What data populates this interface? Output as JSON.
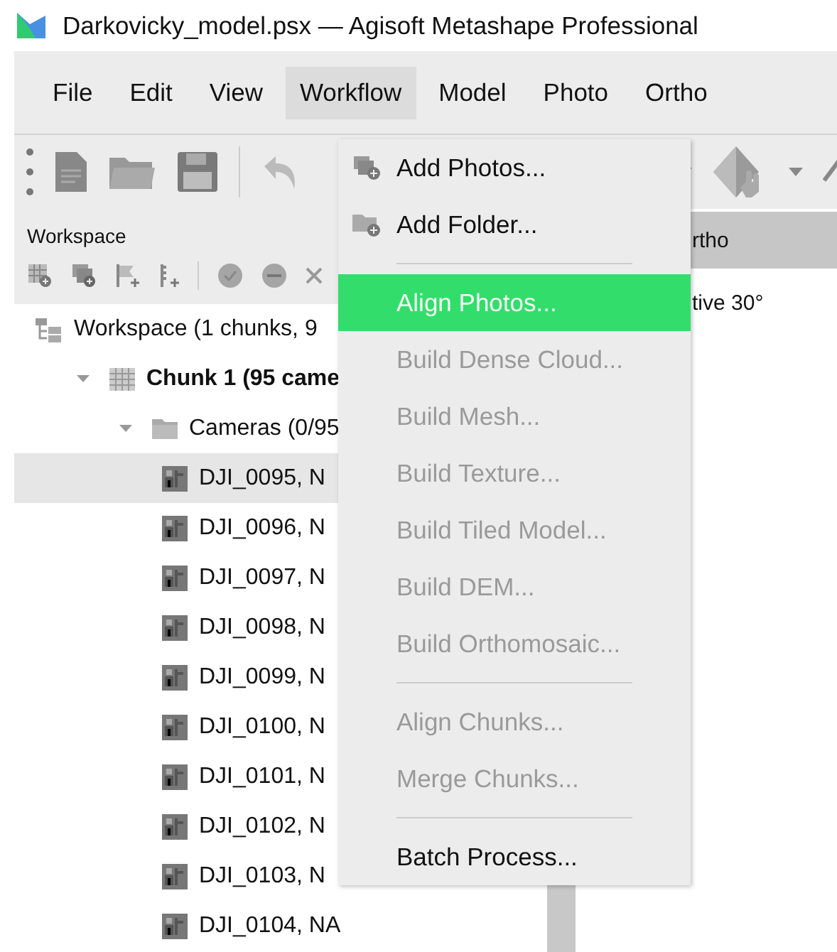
{
  "window": {
    "title": "Darkovicky_model.psx — Agisoft Metashape Professional"
  },
  "menu_bar": [
    {
      "label": "File",
      "selected": false
    },
    {
      "label": "Edit",
      "selected": false
    },
    {
      "label": "View",
      "selected": false
    },
    {
      "label": "Workflow",
      "selected": true
    },
    {
      "label": "Model",
      "selected": false
    },
    {
      "label": "Photo",
      "selected": false
    },
    {
      "label": "Ortho",
      "selected": false
    }
  ],
  "workspace_panel": {
    "title": "Workspace",
    "tree": [
      {
        "kind": "workspace",
        "label": "Workspace (1 chunks, 9",
        "children": [
          {
            "kind": "chunk",
            "label": "Chunk 1 (95 came",
            "expanded": true,
            "children": [
              {
                "kind": "folder",
                "label": "Cameras (0/95",
                "expanded": true,
                "children": [
                  {
                    "kind": "camera",
                    "label": "DJI_0095, N",
                    "selected": true
                  },
                  {
                    "kind": "camera",
                    "label": "DJI_0096, N",
                    "selected": false
                  },
                  {
                    "kind": "camera",
                    "label": "DJI_0097, N",
                    "selected": false
                  },
                  {
                    "kind": "camera",
                    "label": "DJI_0098, N",
                    "selected": false
                  },
                  {
                    "kind": "camera",
                    "label": "DJI_0099, N",
                    "selected": false
                  },
                  {
                    "kind": "camera",
                    "label": "DJI_0100, N",
                    "selected": false
                  },
                  {
                    "kind": "camera",
                    "label": "DJI_0101, N",
                    "selected": false
                  },
                  {
                    "kind": "camera",
                    "label": "DJI_0102, N",
                    "selected": false
                  },
                  {
                    "kind": "camera",
                    "label": "DJI_0103, N",
                    "selected": false
                  },
                  {
                    "kind": "camera",
                    "label": "DJI_0104, NA",
                    "selected": false
                  }
                ]
              }
            ]
          }
        ]
      }
    ]
  },
  "view_pane": {
    "header": "rtho",
    "rows": [
      "tive 30°"
    ]
  },
  "workflow_menu": {
    "items": [
      {
        "kind": "add-photos",
        "label": "Add Photos...",
        "disabled": false,
        "selected": false
      },
      {
        "kind": "add-folder",
        "label": "Add Folder...",
        "disabled": false,
        "selected": false
      },
      {
        "kind": "separator"
      },
      {
        "kind": "item",
        "label": "Align Photos...",
        "disabled": false,
        "selected": true
      },
      {
        "kind": "item",
        "label": "Build Dense Cloud...",
        "disabled": true,
        "selected": false
      },
      {
        "kind": "item",
        "label": "Build Mesh...",
        "disabled": true,
        "selected": false
      },
      {
        "kind": "item",
        "label": "Build Texture...",
        "disabled": true,
        "selected": false
      },
      {
        "kind": "item",
        "label": "Build Tiled Model...",
        "disabled": true,
        "selected": false
      },
      {
        "kind": "item",
        "label": "Build DEM...",
        "disabled": true,
        "selected": false
      },
      {
        "kind": "item",
        "label": "Build Orthomosaic...",
        "disabled": true,
        "selected": false
      },
      {
        "kind": "separator"
      },
      {
        "kind": "item",
        "label": "Align Chunks...",
        "disabled": true,
        "selected": false
      },
      {
        "kind": "item",
        "label": "Merge Chunks...",
        "disabled": true,
        "selected": false
      },
      {
        "kind": "separator"
      },
      {
        "kind": "item",
        "label": "Batch Process...",
        "disabled": false,
        "selected": false
      }
    ]
  }
}
